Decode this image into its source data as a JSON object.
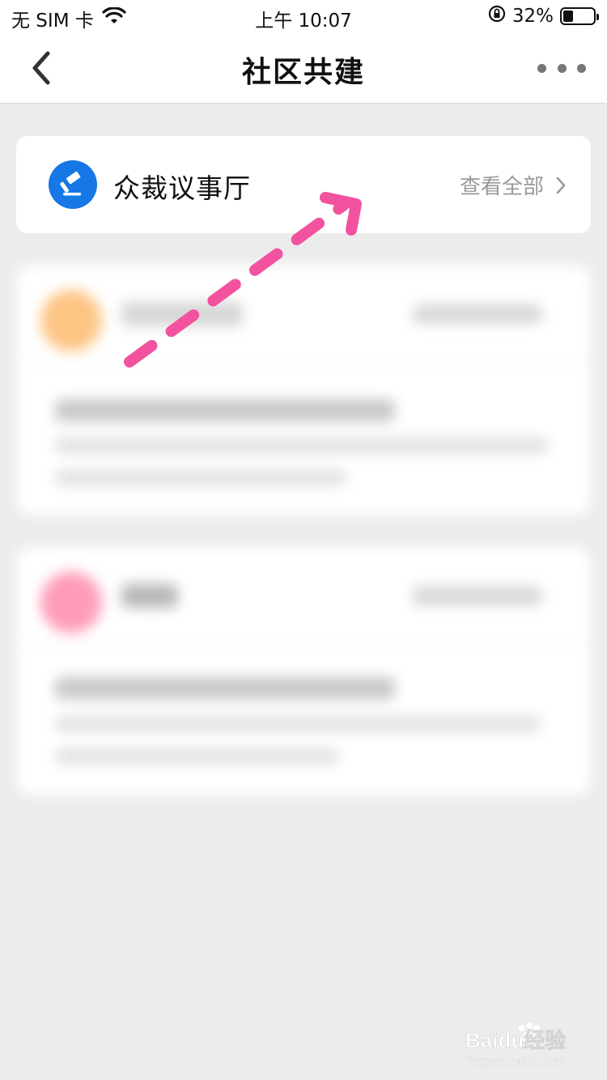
{
  "status_bar": {
    "carrier": "无 SIM 卡",
    "time": "上午 10:07",
    "battery_percent": "32%",
    "battery_level": 0.32
  },
  "nav": {
    "title": "社区共建"
  },
  "hall_card": {
    "title": "众裁议事厅",
    "view_all": "查看全部"
  },
  "watermark": {
    "brand": "Baidu经验",
    "site": "jingyan.baidu.com"
  },
  "colors": {
    "accent_blue": "#1677e6",
    "annotation_pink": "#f2529e",
    "background": "#ececec"
  },
  "icons": {
    "back": "chevron-left-icon",
    "more": "more-dots-icon",
    "hall": "gavel-icon",
    "view_all": "chevron-right-icon"
  }
}
